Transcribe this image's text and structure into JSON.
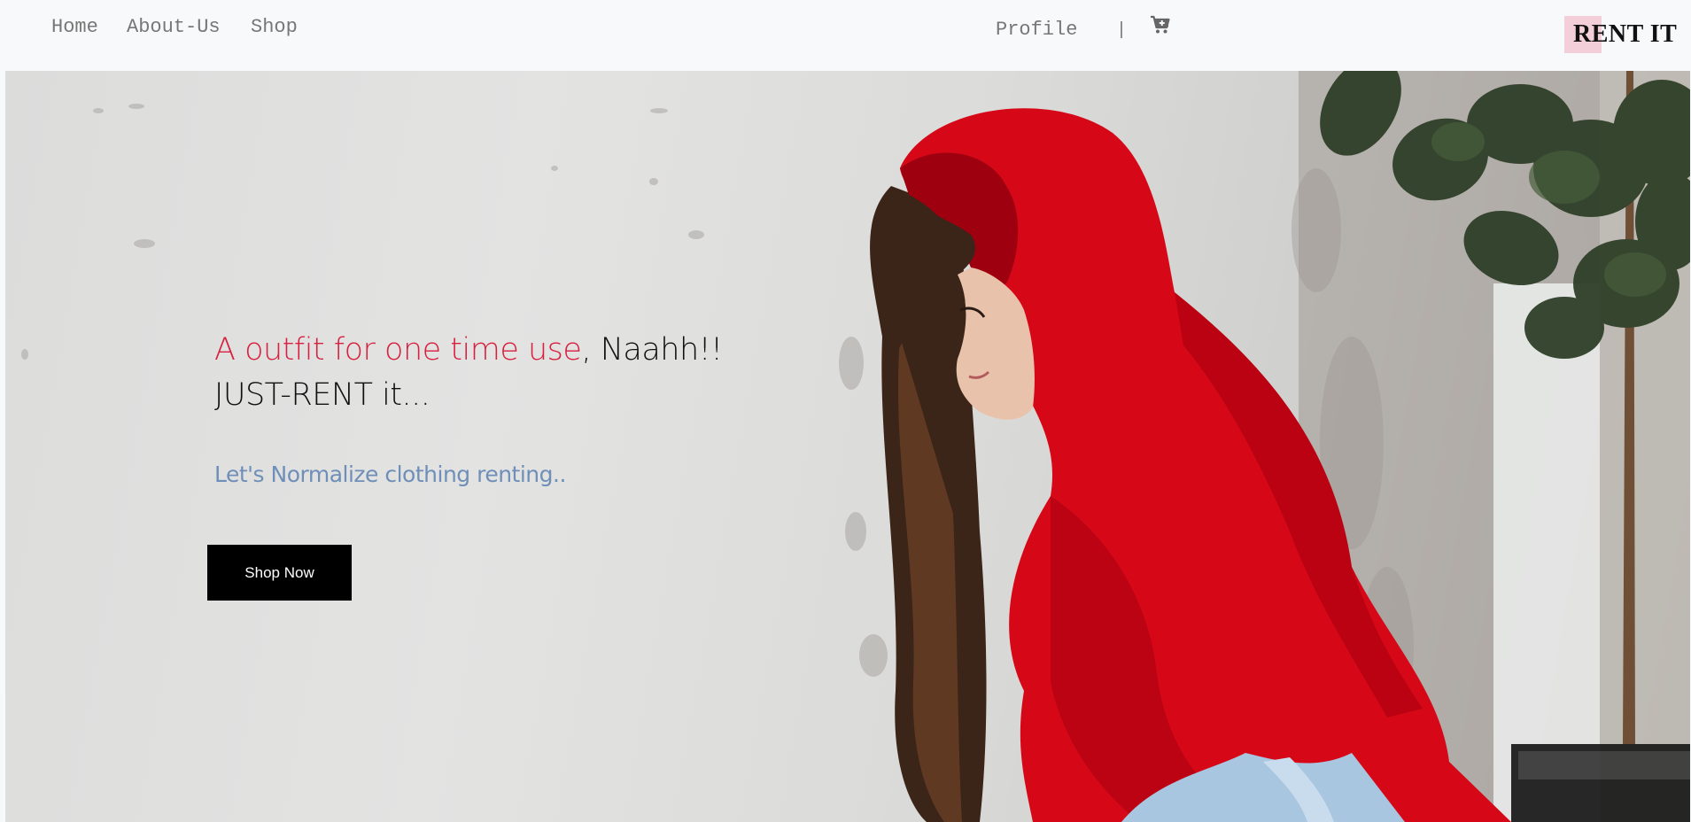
{
  "nav": {
    "home": "Home",
    "about": "About-Us",
    "shop": "Shop",
    "profile": "Profile",
    "separator": "|",
    "cart_icon": "cart-plus-icon",
    "brand": "RENT IT"
  },
  "hero": {
    "headline_accent": "A outfit for one time use",
    "headline_rest": ", Naahh!!",
    "headline_line2": "JUST-RENT it...",
    "subline": "Let's Normalize clothing renting..",
    "cta_label": "Shop Now",
    "image": "woman-in-red-hoodie-photo"
  },
  "colors": {
    "accent_red": "#d8203f",
    "subline_blue": "#6f8fb8",
    "brand_highlight": "#f2cfd9",
    "button_bg": "#000000"
  }
}
